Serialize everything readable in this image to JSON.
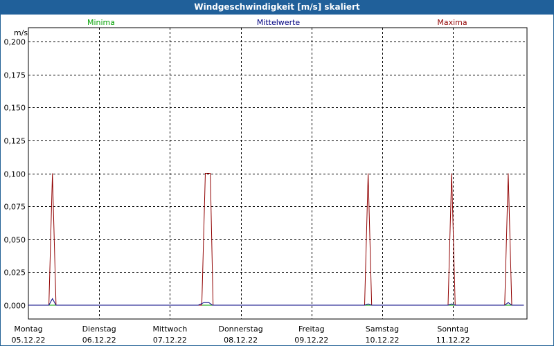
{
  "window": {
    "title": "Windgeschwindigkeit [m/s] skaliert"
  },
  "legend": {
    "min_label": "Minima",
    "mean_label": "Mittelwerte",
    "max_label": "Maxima"
  },
  "colors": {
    "min": "#00a000",
    "mean": "#000080",
    "max": "#900000",
    "title_bg": "#20609a"
  },
  "chart_data": {
    "type": "line",
    "ylabel": "m/s",
    "ylim": [
      0,
      0.2
    ],
    "yticks": [
      "0,200",
      "0,175",
      "0,150",
      "0,125",
      "0,100",
      "0,075",
      "0,050",
      "0,025",
      "0,000"
    ],
    "ytick_values": [
      0.2,
      0.175,
      0.15,
      0.125,
      0.1,
      0.075,
      0.05,
      0.025,
      0.0
    ],
    "xlim": [
      0,
      7
    ],
    "x_categories": [
      {
        "day": "Montag",
        "date": "05.12.22"
      },
      {
        "day": "Dienstag",
        "date": "06.12.22"
      },
      {
        "day": "Mittwoch",
        "date": "07.12.22"
      },
      {
        "day": "Donnerstag",
        "date": "08.12.22"
      },
      {
        "day": "Freitag",
        "date": "09.12.22"
      },
      {
        "day": "Samstag",
        "date": "10.12.22"
      },
      {
        "day": "Sonntag",
        "date": "11.12.22"
      }
    ],
    "grid": true,
    "series": [
      {
        "name": "Minima",
        "color": "#00a000",
        "points": [
          [
            0,
            0
          ],
          [
            7,
            0
          ]
        ]
      },
      {
        "name": "Mittelwerte",
        "color": "#000080",
        "points": [
          [
            0,
            0
          ],
          [
            0.29,
            0
          ],
          [
            0.34,
            0.005
          ],
          [
            0.39,
            0
          ],
          [
            2.4,
            0
          ],
          [
            2.48,
            0.002
          ],
          [
            2.55,
            0.002
          ],
          [
            2.6,
            0
          ],
          [
            4.75,
            0
          ],
          [
            4.8,
            0.001
          ],
          [
            4.85,
            0
          ],
          [
            5.93,
            0
          ],
          [
            5.98,
            0.001
          ],
          [
            6.03,
            0
          ],
          [
            6.73,
            0
          ],
          [
            6.78,
            0.002
          ],
          [
            6.83,
            0
          ],
          [
            7,
            0
          ]
        ]
      },
      {
        "name": "Maxima",
        "color": "#900000",
        "points": [
          [
            0,
            0
          ],
          [
            0.29,
            0
          ],
          [
            0.34,
            0.1
          ],
          [
            0.39,
            0
          ],
          [
            2.45,
            0
          ],
          [
            2.5,
            0.1
          ],
          [
            2.57,
            0.1
          ],
          [
            2.61,
            0
          ],
          [
            4.75,
            0
          ],
          [
            4.8,
            0.1
          ],
          [
            4.85,
            0
          ],
          [
            5.93,
            0
          ],
          [
            5.98,
            0.1
          ],
          [
            6.03,
            0
          ],
          [
            6.73,
            0
          ],
          [
            6.78,
            0.1
          ],
          [
            6.83,
            0
          ],
          [
            7,
            0
          ]
        ]
      }
    ]
  }
}
